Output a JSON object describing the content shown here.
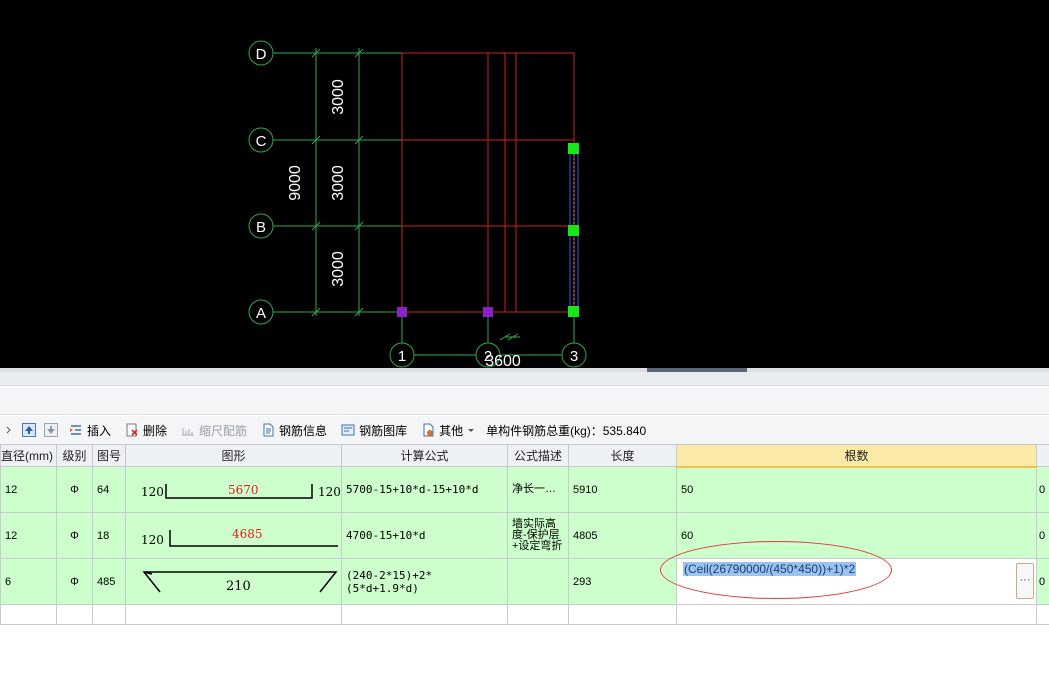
{
  "cad": {
    "axis_rows": [
      "D",
      "C",
      "B",
      "A"
    ],
    "axis_cols": [
      "1",
      "2",
      "3"
    ],
    "dim_segments": [
      "3000",
      "3000",
      "3000"
    ],
    "dim_total": "9000",
    "dim_bottom": "3600"
  },
  "toolbar": {
    "insert_label": "插入",
    "delete_label": "删除",
    "scale_label": "缩尺配筋",
    "rebar_info_label": "钢筋信息",
    "rebar_lib_label": "钢筋图库",
    "other_label": "其他",
    "weight_label": "单构件钢筋总重(kg)：535.840"
  },
  "table": {
    "headers": [
      "直径(mm)",
      "级别",
      "图号",
      "图形",
      "计算公式",
      "公式描述",
      "长度",
      "根数",
      ""
    ],
    "rows": [
      {
        "diameter": "12",
        "grade": "Φ",
        "fig": "64",
        "shape_left": "120",
        "shape_mid": "5670",
        "shape_right": "120",
        "formula": "5700-15+10*d-15+10*d",
        "desc": "净长一…",
        "length": "5910",
        "count": "50",
        "extra": "0"
      },
      {
        "diameter": "12",
        "grade": "Φ",
        "fig": "18",
        "shape_left": "120",
        "shape_mid": "4685",
        "formula": "4700-15+10*d",
        "desc": "墙实际高度-保护层+设定弯折",
        "length": "4805",
        "count": "60",
        "extra": "0"
      },
      {
        "diameter": "6",
        "grade": "Φ",
        "fig": "485",
        "shape_mid": "210",
        "formula": "(240-2*15)+2*(5*d+1.9*d)",
        "desc": "",
        "length": "293",
        "count": "(Ceil(26790000/(450*450))+1)*2",
        "extra": "0"
      }
    ],
    "edit_button": "···"
  },
  "colors": {
    "cad_bg": "#000000",
    "grid_line": "#cc2222",
    "axis_green": "#2fa84a",
    "row_green": "#ccffcc",
    "node_green": "#19e619",
    "node_purple": "#8a22c9",
    "annotation_red": "#e23b3b"
  }
}
